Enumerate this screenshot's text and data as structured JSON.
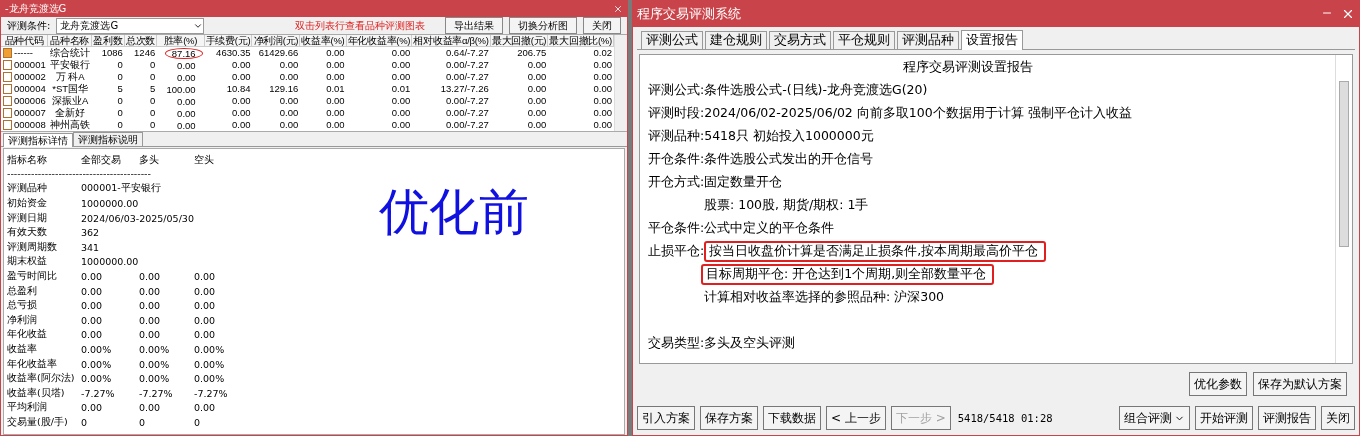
{
  "left_window": {
    "title": "-龙舟竞渡选G",
    "toolbar": {
      "condition_label": "评测条件:",
      "condition_value": "龙舟竞渡选G",
      "hint": "双击列表行查看品种评测图表",
      "buttons": [
        "导出结果",
        "切换分析图",
        "关闭"
      ]
    },
    "table": {
      "columns": [
        "品种代码",
        "品种名称",
        "盈利数",
        "总次数",
        "胜率(%)",
        "手续费(元)",
        "净利润(元)",
        "收益率(%)",
        "年化收益率(%)",
        "相对收益率α/β(%)",
        "最大回撤(元)",
        "最大回撤比(%)"
      ],
      "rows": [
        {
          "selected": true,
          "win_rate_circled": true,
          "cells": [
            "------",
            "综合统计",
            "1086",
            "1246",
            "87.16",
            "4630.35",
            "61429.66",
            "0.00",
            "0.00",
            "0.64/-7.27",
            "206.75",
            "0.02"
          ]
        },
        {
          "selected": false,
          "cells": [
            "000001",
            "平安银行",
            "0",
            "0",
            "0.00",
            "0.00",
            "0.00",
            "0.00",
            "0.00",
            "0.00/-7.27",
            "0.00",
            "0.00"
          ]
        },
        {
          "selected": false,
          "cells": [
            "000002",
            "万 科A",
            "0",
            "0",
            "0.00",
            "0.00",
            "0.00",
            "0.00",
            "0.00",
            "0.00/-7.27",
            "0.00",
            "0.00"
          ]
        },
        {
          "selected": false,
          "cells": [
            "000004",
            "*ST国华",
            "5",
            "5",
            "100.00",
            "10.84",
            "129.16",
            "0.01",
            "0.01",
            "13.27/-7.26",
            "0.00",
            "0.00"
          ]
        },
        {
          "selected": false,
          "cells": [
            "000006",
            "深振业A",
            "0",
            "0",
            "0.00",
            "0.00",
            "0.00",
            "0.00",
            "0.00",
            "0.00/-7.27",
            "0.00",
            "0.00"
          ]
        },
        {
          "selected": false,
          "cells": [
            "000007",
            "全新好",
            "0",
            "0",
            "0.00",
            "0.00",
            "0.00",
            "0.00",
            "0.00",
            "0.00/-7.27",
            "0.00",
            "0.00"
          ]
        },
        {
          "selected": false,
          "cells": [
            "000008",
            "神州高铁",
            "0",
            "0",
            "0.00",
            "0.00",
            "0.00",
            "0.00",
            "0.00",
            "0.00/-7.27",
            "0.00",
            "0.00"
          ]
        }
      ]
    },
    "tabs": [
      {
        "label": "评测指标详情",
        "selected": true
      },
      {
        "label": "评测指标说明",
        "selected": false
      }
    ],
    "details": {
      "header": [
        "指标名称",
        "全部交易",
        "多头",
        "空头"
      ],
      "separator": "------------------------------------------",
      "rows": [
        {
          "label": "评测品种",
          "values": [
            "000001-平安银行"
          ]
        },
        {
          "label": "初始资金",
          "values": [
            "1000000.00"
          ]
        },
        {
          "label": "评测日期",
          "values": [
            "2024/06/03-2025/05/30"
          ]
        },
        {
          "label": "有效天数",
          "values": [
            "362"
          ]
        },
        {
          "label": "评测周期数",
          "values": [
            "341"
          ]
        },
        {
          "label": "期末权益",
          "values": [
            "1000000.00"
          ]
        },
        {
          "label": "盈亏时间比",
          "values": [
            "0.00",
            "0.00",
            "0.00"
          ]
        },
        {
          "label": "总盈利",
          "values": [
            "0.00",
            "0.00",
            "0.00"
          ]
        },
        {
          "label": "总亏损",
          "values": [
            "0.00",
            "0.00",
            "0.00"
          ]
        },
        {
          "label": "净利润",
          "values": [
            "0.00",
            "0.00",
            "0.00"
          ]
        },
        {
          "label": "年化收益",
          "values": [
            "0.00",
            "0.00",
            "0.00"
          ]
        },
        {
          "label": "收益率",
          "values": [
            "0.00%",
            "0.00%",
            "0.00%"
          ]
        },
        {
          "label": "年化收益率",
          "values": [
            "0.00%",
            "0.00%",
            "0.00%"
          ]
        },
        {
          "label": "收益率(阿尔法)",
          "values": [
            "0.00%",
            "0.00%",
            "0.00%"
          ]
        },
        {
          "label": "收益率(贝塔)",
          "values": [
            "-7.27%",
            "-7.27%",
            "-7.27%"
          ]
        },
        {
          "label": "平均利润",
          "values": [
            "0.00",
            "0.00",
            "0.00"
          ]
        },
        {
          "label": "交易量(股/手)",
          "values": [
            "0",
            "0",
            "0"
          ]
        }
      ]
    },
    "annotation": "优化前"
  },
  "right_window": {
    "title": "程序交易评测系统",
    "tabs": [
      {
        "label": "评测公式",
        "selected": false
      },
      {
        "label": "建仓规则",
        "selected": false
      },
      {
        "label": "交易方式",
        "selected": false
      },
      {
        "label": "平仓规则",
        "selected": false
      },
      {
        "label": "评测品种",
        "selected": false
      },
      {
        "label": "设置报告",
        "selected": true
      }
    ],
    "report": {
      "title": "程序交易评测设置报告",
      "lines": [
        {
          "kind": "field",
          "label": "评测公式:",
          "value": "条件选股公式-(日线)-龙舟竞渡选G(20)",
          "boxed": false
        },
        {
          "kind": "field",
          "label": "评测时段:",
          "value": "2024/06/02-2025/06/02 向前多取100个数据用于计算 强制平仓计入收益",
          "boxed": false
        },
        {
          "kind": "field",
          "label": "评测品种:",
          "value": "5418只 初始投入1000000元",
          "boxed": false
        },
        {
          "kind": "field",
          "label": "开仓条件:",
          "value": "条件选股公式发出的开仓信号",
          "boxed": false
        },
        {
          "kind": "field",
          "label": "开仓方式:",
          "value": "固定数量开仓",
          "boxed": false
        },
        {
          "kind": "indent",
          "value": "股票: 100股, 期货/期权: 1手",
          "boxed": false
        },
        {
          "kind": "field",
          "label": "平仓条件:",
          "value": "公式中定义的平仓条件",
          "boxed": false
        },
        {
          "kind": "field",
          "label": "止损平仓:",
          "value": "按当日收盘价计算是否满足止损条件,按本周期最高价平仓",
          "boxed": true
        },
        {
          "kind": "indent",
          "value": "目标周期平仓: 开仓达到1个周期,则全部数量平仓",
          "boxed": true
        },
        {
          "kind": "indent",
          "value": "计算相对收益率选择的参照品种: 沪深300",
          "boxed": false
        },
        {
          "kind": "gap"
        },
        {
          "kind": "field",
          "label": "交易类型:",
          "value": "多头及空头评测",
          "boxed": false
        }
      ]
    },
    "action_buttons": [
      "优化参数",
      "保存为默认方案"
    ],
    "bottom_buttons": [
      {
        "label": "引入方案",
        "disabled": false
      },
      {
        "label": "保存方案",
        "disabled": false
      },
      {
        "label": "下载数据",
        "disabled": false
      },
      {
        "label": "< 上一步",
        "disabled": false
      },
      {
        "label": "下一步 >",
        "disabled": true
      }
    ],
    "progress": "5418/5418 01:28",
    "right_buttons": [
      {
        "label": "组合评测",
        "dropdown": true
      },
      {
        "label": "开始评测",
        "dropdown": false
      },
      {
        "label": "评测报告",
        "dropdown": false
      },
      {
        "label": "关闭",
        "dropdown": false
      }
    ]
  }
}
